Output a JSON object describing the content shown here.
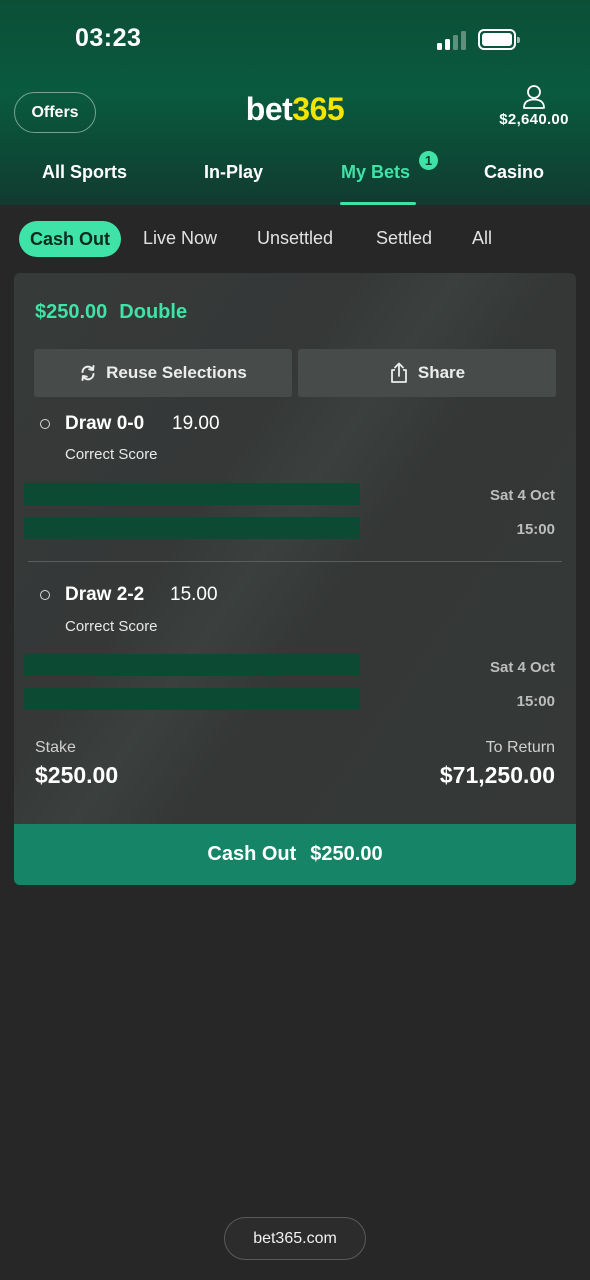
{
  "status_bar": {
    "time": "03:23"
  },
  "header": {
    "offers_label": "Offers",
    "logo": {
      "part1": "bet",
      "part2": "365"
    },
    "balance": "$2,640.00",
    "icons": [
      "user-icon",
      "signal-icon",
      "battery-icon"
    ]
  },
  "main_tabs": [
    {
      "label": "All Sports"
    },
    {
      "label": "In-Play"
    },
    {
      "label": "My Bets",
      "badge": "1",
      "active": true
    },
    {
      "label": "Casino"
    }
  ],
  "filter_tabs": [
    {
      "label": "Cash Out",
      "active": true
    },
    {
      "label": "Live Now"
    },
    {
      "label": "Unsettled"
    },
    {
      "label": "Settled"
    },
    {
      "label": "All"
    }
  ],
  "bet": {
    "amount": "$250.00",
    "type": "Double",
    "reuse_label": "Reuse Selections",
    "share_label": "Share",
    "selections": [
      {
        "name": "Draw 0-0",
        "odds": "19.00",
        "market": "Correct Score",
        "date": "Sat 4 Oct",
        "time": "15:00"
      },
      {
        "name": "Draw 2-2",
        "odds": "15.00",
        "market": "Correct Score",
        "date": "Sat 4 Oct",
        "time": "15:00"
      }
    ],
    "stake_label": "Stake",
    "stake_value": "$250.00",
    "return_label": "To Return",
    "return_value": "$71,250.00",
    "cashout_label": "Cash Out",
    "cashout_value": "$250.00"
  },
  "footer": {
    "url": "bet365.com"
  },
  "colors": {
    "accent": "#3fe3a8",
    "logo_yellow": "#f5e400",
    "cashout_green": "#168466",
    "header_green": "#0a5a3f"
  }
}
